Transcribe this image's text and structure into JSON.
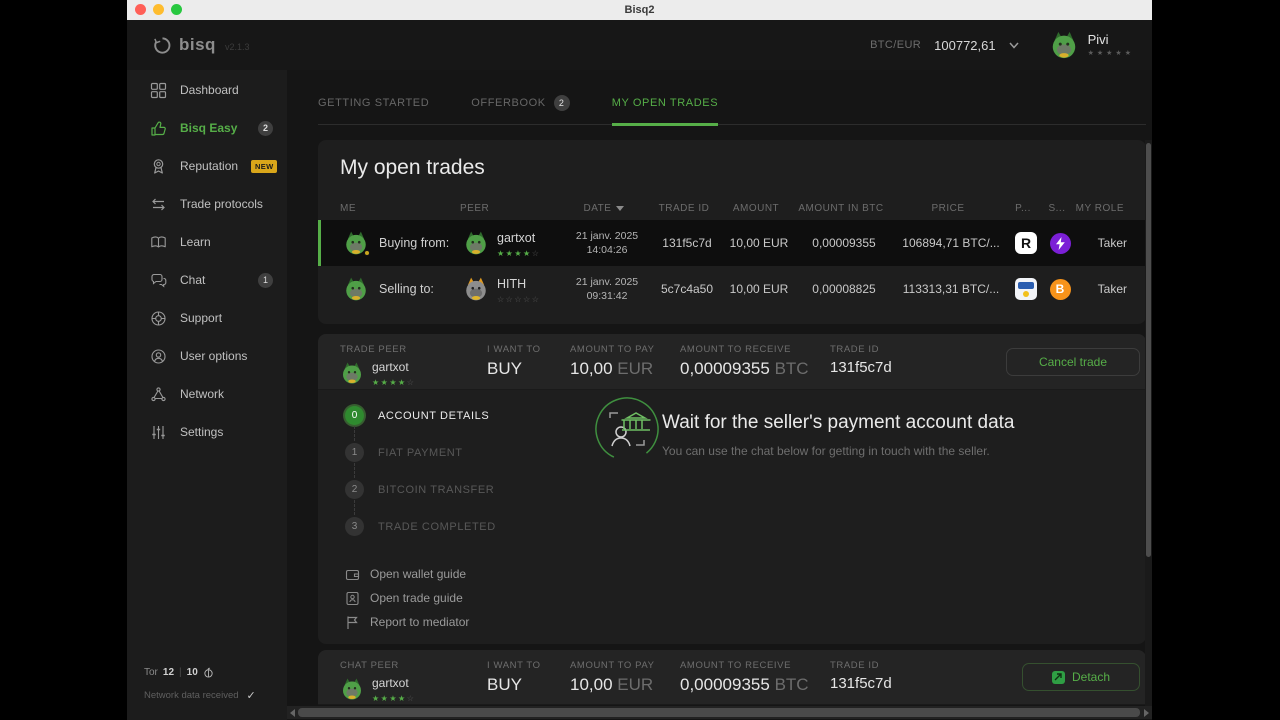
{
  "window": {
    "titlebar_title": "Bisq2"
  },
  "header": {
    "logo_text": "bisq",
    "version": "v2.1.3",
    "market": {
      "pair": "BTC/EUR",
      "price": "100772,61"
    },
    "profile": {
      "name": "Pivi",
      "stars": "★★★★★"
    }
  },
  "sidebar": {
    "items": [
      {
        "label": "Dashboard"
      },
      {
        "label": "Bisq Easy",
        "badge": "2"
      },
      {
        "label": "Reputation",
        "tag": "NEW"
      },
      {
        "label": "Trade protocols"
      },
      {
        "label": "Learn"
      },
      {
        "label": "Chat",
        "badge": "1"
      },
      {
        "label": "Support"
      },
      {
        "label": "User options"
      },
      {
        "label": "Network"
      },
      {
        "label": "Settings"
      }
    ],
    "footer": {
      "tor_label": "Tor",
      "tor_value": "12",
      "separator": "|",
      "i2p_value": "10",
      "status": "Network data received",
      "check": "✓"
    }
  },
  "tabs": [
    {
      "label": "GETTING STARTED"
    },
    {
      "label": "OFFERBOOK",
      "badge": "2"
    },
    {
      "label": "MY OPEN TRADES"
    }
  ],
  "trades_card": {
    "title": "My open trades",
    "columns": [
      "ME",
      "PEER",
      "DATE",
      "TRADE ID",
      "AMOUNT",
      "AMOUNT IN BTC",
      "PRICE",
      "P...",
      "S...",
      "MY ROLE"
    ],
    "rows": [
      {
        "direction": "Buying from:",
        "peer": "gartxot",
        "stars_filled": "★★★★",
        "stars_empty": "☆",
        "date": "21 janv. 2025",
        "time": "14:04:26",
        "trade_id": "131f5c7d",
        "amount": "10,00 EUR",
        "amount_btc": "0,00009355",
        "price": "106894,71 BTC/...",
        "payment_method": "Revolut",
        "payment_glyph": "R",
        "settlement_method": "Lightning",
        "role": "Taker"
      },
      {
        "direction": "Selling to:",
        "peer": "HITH",
        "stars_filled": "",
        "stars_empty": "☆☆☆☆☆",
        "date": "21 janv. 2025",
        "time": "09:31:42",
        "trade_id": "5c7c4a50",
        "amount": "10,00 EUR",
        "amount_btc": "0,00008825",
        "price": "113313,31 BTC/...",
        "payment_method": "SEPA",
        "settlement_method": "Bitcoin",
        "settlement_glyph": "B",
        "role": "Taker"
      }
    ]
  },
  "trade_summary": {
    "peer_name": "gartxot",
    "peer_stars_filled": "★★★★",
    "peer_stars_empty": "☆",
    "i_want_to_label": "I WANT TO",
    "direction": "BUY",
    "amount_to_pay_label": "AMOUNT TO PAY",
    "pay_amount": "10,00",
    "pay_code": "EUR",
    "amount_to_receive_label": "AMOUNT TO RECEIVE",
    "receive_amount": "0,00009355",
    "receive_code": "BTC",
    "trade_id_label": "TRADE ID",
    "trade_id": "131f5c7d"
  },
  "trade_detail": {
    "peer_label": "TRADE PEER",
    "cancel_button": "Cancel trade",
    "steps": [
      {
        "num": "0",
        "label": "ACCOUNT DETAILS"
      },
      {
        "num": "1",
        "label": "FIAT PAYMENT"
      },
      {
        "num": "2",
        "label": "BITCOIN TRANSFER"
      },
      {
        "num": "3",
        "label": "TRADE COMPLETED"
      }
    ],
    "message": {
      "title": "Wait for the seller's payment account data",
      "subtitle": "You can use the chat below for getting in touch with the seller."
    },
    "links": [
      {
        "label": "Open wallet guide"
      },
      {
        "label": "Open trade guide"
      },
      {
        "label": "Report to mediator"
      }
    ]
  },
  "chat_bar": {
    "peer_label": "CHAT PEER",
    "detach_button": "Detach"
  },
  "colors": {
    "accent_green": "#56AE48",
    "badge_yellow": "#D9A61A",
    "lightning_purple": "#7B1FD6",
    "bitcoin_orange": "#F7931A",
    "revolut_white": "#FFFFFF"
  }
}
